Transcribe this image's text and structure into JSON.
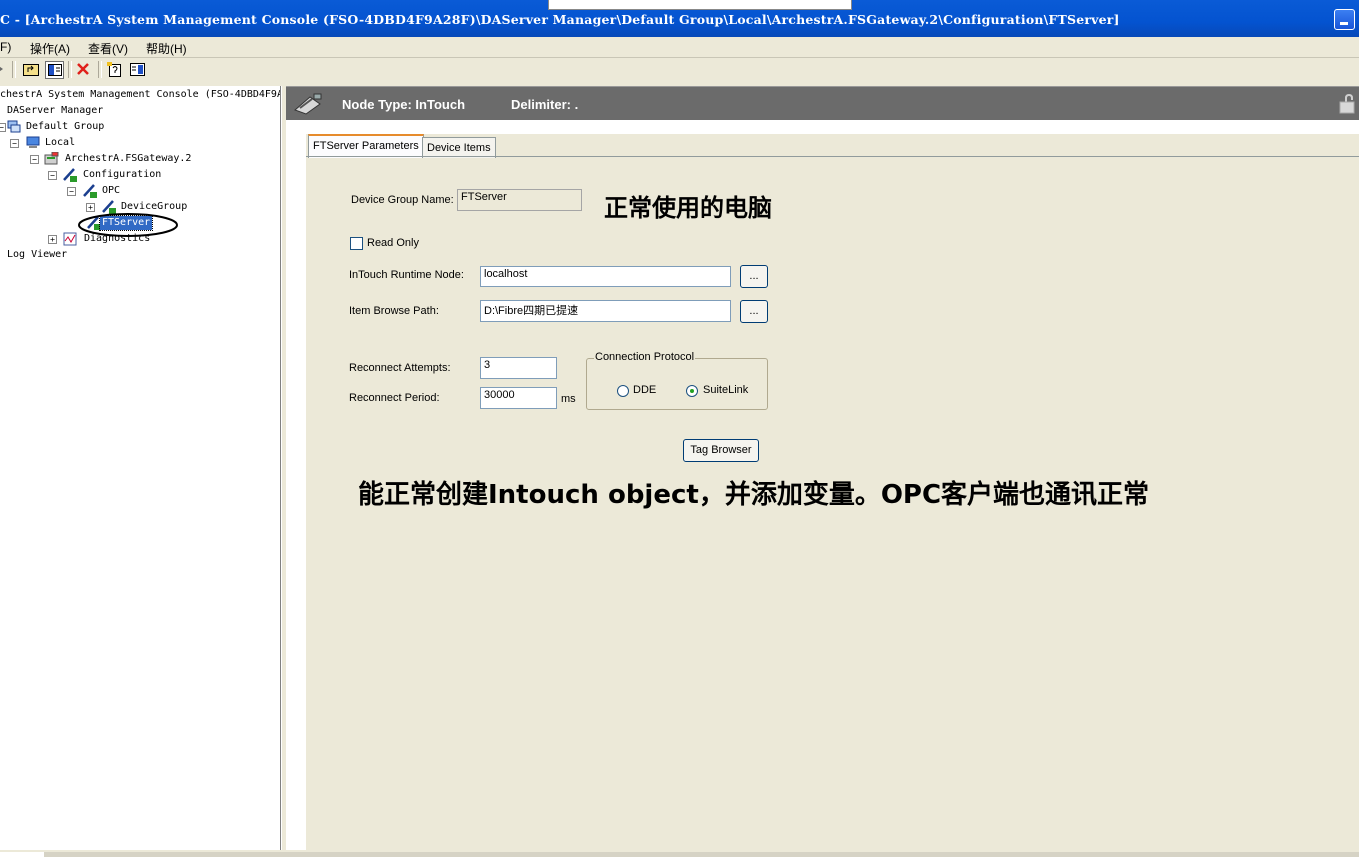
{
  "window": {
    "title": "C - [ArchestrA System Management Console (FSO-4DBD4F9A28F)\\DAServer Manager\\Default Group\\Local\\ArchestrA.FSGateway.2\\Configuration\\FTServer]"
  },
  "menu": [
    "F)",
    "操作(A)",
    "查看(V)",
    "帮助(H)"
  ],
  "toolbar": {
    "icons": [
      "back-arrow-icon",
      "up-folder-icon",
      "show-hide-tree-icon",
      "delete-icon",
      "properties-icon",
      "help-pane-icon"
    ]
  },
  "tree": {
    "root": "chestrA System Management Console (FSO-4DBD4F9A",
    "daserver_manager": "DAServer Manager",
    "default_group": "Default Group",
    "local": "Local",
    "gateway": "ArchestrA.FSGateway.2",
    "configuration": "Configuration",
    "opc": "OPC",
    "device_group": "DeviceGroup",
    "ftserver": "FTServer",
    "diagnostics": "Diagnostics",
    "log_viewer": "Log Viewer"
  },
  "header": {
    "node_type": "Node Type: InTouch",
    "delimiter": "Delimiter: ."
  },
  "tabs": [
    "FTServer Parameters",
    "Device Items"
  ],
  "form": {
    "device_group_name_label": "Device Group Name:",
    "device_group_name_value": "FTServer",
    "read_only_label": "Read Only",
    "read_only_checked": false,
    "runtime_node_label": "InTouch Runtime Node:",
    "runtime_node_value": "localhost",
    "browse_path_label": "Item Browse Path:",
    "browse_path_value": "D:\\Fibre四期已提速",
    "browse_button": "...",
    "reconnect_attempts_label": "Reconnect Attempts:",
    "reconnect_attempts_value": "3",
    "reconnect_period_label": "Reconnect Period:",
    "reconnect_period_value": "30000",
    "reconnect_period_unit": "ms",
    "protocol_group_label": "Connection Protocol",
    "protocol_dde": "DDE",
    "protocol_suitelink": "SuiteLink",
    "protocol_selected": "SuiteLink",
    "tag_browser_button": "Tag Browser"
  },
  "annotations": {
    "note1": "正常使用的电脑",
    "note2": "能正常创建Intouch object，并添加变量。OPC客户端也通讯正常"
  }
}
